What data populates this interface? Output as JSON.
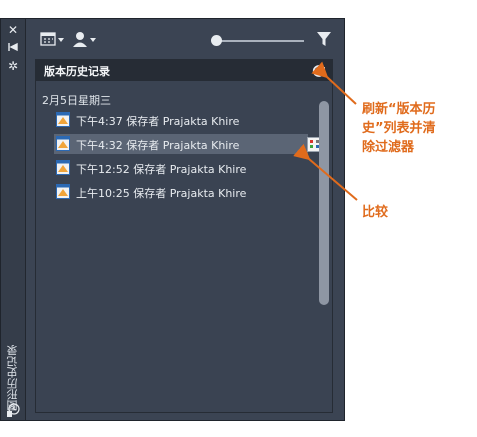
{
  "palette": {
    "vertical_title": "图形历史记录",
    "header_title": "版本历史记录",
    "date_group": "2月5日星期三",
    "rows": [
      {
        "time": "下午4:37",
        "saved_by": "保存者",
        "user": "Prajakta Khire"
      },
      {
        "time": "下午4:32",
        "saved_by": "保存者",
        "user": "Prajakta Khire"
      },
      {
        "time": "下午12:52",
        "saved_by": "保存者",
        "user": "Prajakta Khire"
      },
      {
        "time": "上午10:25",
        "saved_by": "保存者",
        "user": "Prajakta Khire"
      }
    ],
    "selected_row_index": 1,
    "icons": [
      "close-icon",
      "auto-hide-icon",
      "settings-icon",
      "calendar-icon",
      "user-icon",
      "filter-icon",
      "refresh-icon",
      "compare-icon",
      "drawing-icon",
      "history-icon"
    ]
  },
  "annotations": {
    "refresh_note_line1": "刷新“版本历",
    "refresh_note_line2": "史”列表并清",
    "refresh_note_line3": "除过滤器",
    "compare_note": "比较"
  },
  "colors": {
    "panel": "#3b4453",
    "header": "#262c35",
    "selected": "#5b6575",
    "annotation": "#e06b1c"
  }
}
